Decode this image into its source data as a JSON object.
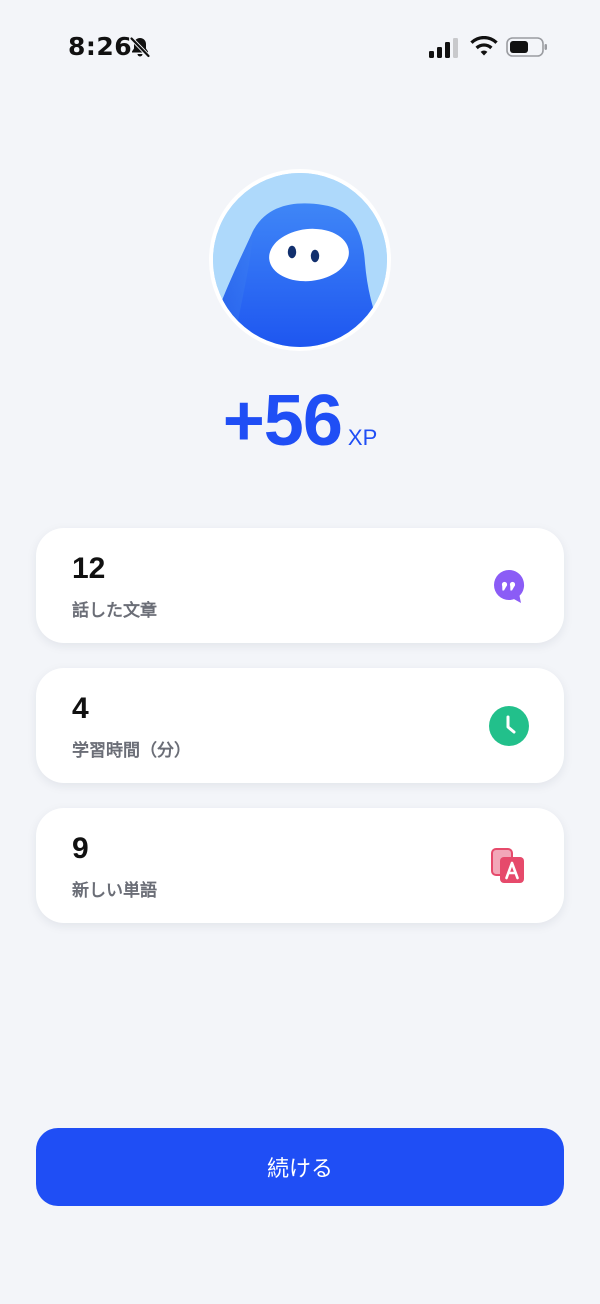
{
  "status_bar": {
    "time": "8:26",
    "icons": [
      "bell-slash-icon",
      "cellular-signal-icon",
      "wifi-icon",
      "battery-icon"
    ]
  },
  "reward": {
    "avatar": "blue-mascot-avatar",
    "value": "+56",
    "unit": "XP"
  },
  "stats": [
    {
      "value": "12",
      "label": "話した文章",
      "icon": "speech-quote-icon",
      "color": "#8b5cf6"
    },
    {
      "value": "4",
      "label": "学習時間（分）",
      "icon": "clock-icon",
      "color": "#22c08b"
    },
    {
      "value": "9",
      "label": "新しい単語",
      "icon": "vocabulary-cards-icon",
      "color": "#e64a6b"
    }
  ],
  "continue_button": {
    "label": "続ける"
  },
  "colors": {
    "accent": "#1f4ef5",
    "background": "#f3f5f9"
  }
}
